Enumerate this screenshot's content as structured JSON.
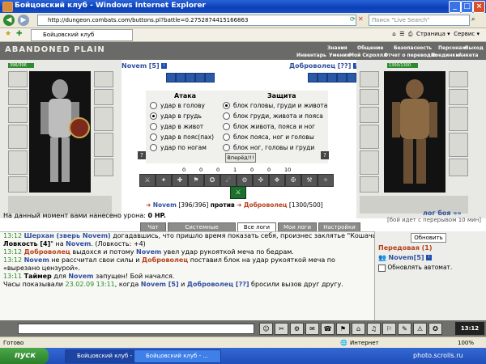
{
  "window": {
    "title": "Бойцовский клуб - Windows Internet Explorer",
    "url": "http://dungeon.combats.com/buttons.pl?battle=0.2752874415166863",
    "search_placeholder": "Поиск \"Live Search\"",
    "tab_title": "Бойцовский клуб",
    "tools": [
      "Страница",
      "Сервис"
    ]
  },
  "game": {
    "logo": "ABANDONED PLAIN",
    "menu_top": [
      "Знания",
      "Общение",
      "Безопасность",
      "Персонаж",
      "Выход"
    ],
    "menu_bottom": [
      "Инвентарь",
      "Умения",
      "Мой Скроллл",
      "Отчет о переводах",
      "Поединки",
      "Анкета"
    ]
  },
  "player": {
    "name": "Novem",
    "level": "[5]",
    "hp": "396/396"
  },
  "enemy": {
    "name": "Доброволец",
    "level": "[??]",
    "hp": "1300/1300"
  },
  "attack": {
    "header": "Атака",
    "options": [
      "удар в голову",
      "удар в грудь",
      "удар в живот",
      "удар в пояс(пах)",
      "удар по ногам"
    ],
    "selected": 1
  },
  "defense": {
    "header": "Защита",
    "options": [
      "блок головы, груди и живота",
      "блок груди, живота и пояса",
      "блок живота, пояса и ног",
      "блок пояса, ног и головы",
      "блок ног, головы и груди"
    ],
    "selected": 0
  },
  "vs_label": "против",
  "forward_button": "Вперёд!!!",
  "counters": [
    "0",
    "0",
    "0",
    "1",
    "0",
    "0",
    "10"
  ],
  "status_line": {
    "player_hp": "[396/396]",
    "enemy_hp": "[1300/500]"
  },
  "damage_text": "На данный момент вами нанесено урона:",
  "damage_value": "0 HP.",
  "battle_log_link": "лог боя »»",
  "battle_log_extra": "[бой идет с перерывом 10 мин]",
  "chat_tabs": [
    "Чат",
    "Системные сообщения",
    "Все логи",
    "Мои логи",
    "Настройки"
  ],
  "chat": [
    {
      "time": "13:12",
      "segments": [
        {
          "t": "Шерхан (зверь Novem)",
          "c": "name"
        },
        {
          "t": " догадавшись, что пришло время показать себя, произнес заклятье \"Кошачья",
          "c": "plain"
        }
      ]
    },
    {
      "time": "",
      "segments": [
        {
          "t": "Ловкость [4]",
          "c": "bold"
        },
        {
          "t": "\" на ",
          "c": "plain"
        },
        {
          "t": "Novem",
          "c": "name"
        },
        {
          "t": ". (Ловкость: +4)",
          "c": "plain"
        }
      ]
    },
    {
      "time": "13:12",
      "segments": [
        {
          "t": "Доброволец",
          "c": "enemy"
        },
        {
          "t": " выдохся и потому ",
          "c": "plain"
        },
        {
          "t": "Novem",
          "c": "name"
        },
        {
          "t": " увел удар рукояткой меча по бедрам.",
          "c": "plain"
        }
      ]
    },
    {
      "time": "13:12",
      "segments": [
        {
          "t": "Novem",
          "c": "name"
        },
        {
          "t": " не рассчитал свои силы и ",
          "c": "plain"
        },
        {
          "t": "Доброволец",
          "c": "enemy"
        },
        {
          "t": " поставил блок на удар рукояткой меча по",
          "c": "plain"
        }
      ]
    },
    {
      "time": "",
      "segments": [
        {
          "t": "«вырезано цензурой».",
          "c": "plain"
        }
      ]
    },
    {
      "time": "13:11",
      "segments": [
        {
          "t": "Таймер",
          "c": "bold"
        },
        {
          "t": " для ",
          "c": "plain"
        },
        {
          "t": "Novem",
          "c": "name"
        },
        {
          "t": " запущен! Бой начался.",
          "c": "plain"
        }
      ]
    },
    {
      "time": "",
      "segments": [
        {
          "t": "Часы показывали ",
          "c": "plain"
        },
        {
          "t": "23.02.09 13:11",
          "c": "ts"
        },
        {
          "t": ", когда ",
          "c": "plain"
        },
        {
          "t": "Novem [5]",
          "c": "name"
        },
        {
          "t": " и ",
          "c": "plain"
        },
        {
          "t": "Доброволец [??]",
          "c": "name"
        },
        {
          "t": " бросили вызов друг другу.",
          "c": "plain"
        }
      ]
    }
  ],
  "right_panel": {
    "refresh": "Обновить",
    "title": "Передовая (1)",
    "member": "Novem[5]",
    "auto_update": "Обновлять автомат."
  },
  "clock": "13:12",
  "status_bar": {
    "ready": "Готово",
    "zone": "Интернет",
    "zoom": "100%"
  },
  "taskbar": {
    "start": "пуск",
    "tasks": [
      "Бойцовский клуб - ...",
      "Бойцовский клуб - ..."
    ],
    "watermark": "photo.scrolls.ru"
  }
}
